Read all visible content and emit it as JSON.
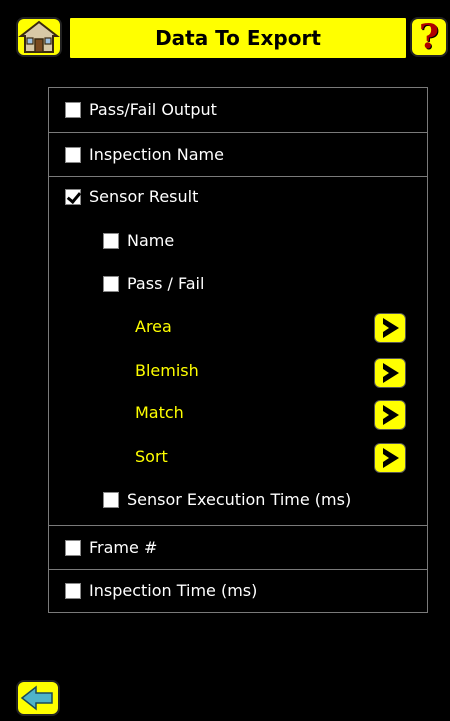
{
  "header": {
    "title": "Data To Export",
    "help_glyph": "?"
  },
  "icons": {
    "home": "home-icon",
    "help": "help-icon",
    "back": "back-arrow-icon",
    "submenu": "chevron-right-icon"
  },
  "colors": {
    "accent": "#ffff00",
    "background": "#000000",
    "text": "#ffffff",
    "divider": "#7a7a7a"
  },
  "items": {
    "pass_fail_output": {
      "label": "Pass/Fail Output",
      "checked": false
    },
    "inspection_name": {
      "label": "Inspection Name",
      "checked": false
    },
    "sensor_result": {
      "label": "Sensor Result",
      "checked": true
    },
    "name": {
      "label": "Name",
      "checked": false
    },
    "pass_fail": {
      "label": "Pass / Fail",
      "checked": false
    },
    "area": {
      "label": "Area"
    },
    "blemish": {
      "label": "Blemish"
    },
    "match": {
      "label": "Match"
    },
    "sort": {
      "label": "Sort"
    },
    "sensor_exec_time": {
      "label": "Sensor Execution Time (ms)",
      "checked": false
    },
    "frame_num": {
      "label": "Frame #",
      "checked": false
    },
    "inspection_time": {
      "label": "Inspection Time (ms)",
      "checked": false
    }
  }
}
